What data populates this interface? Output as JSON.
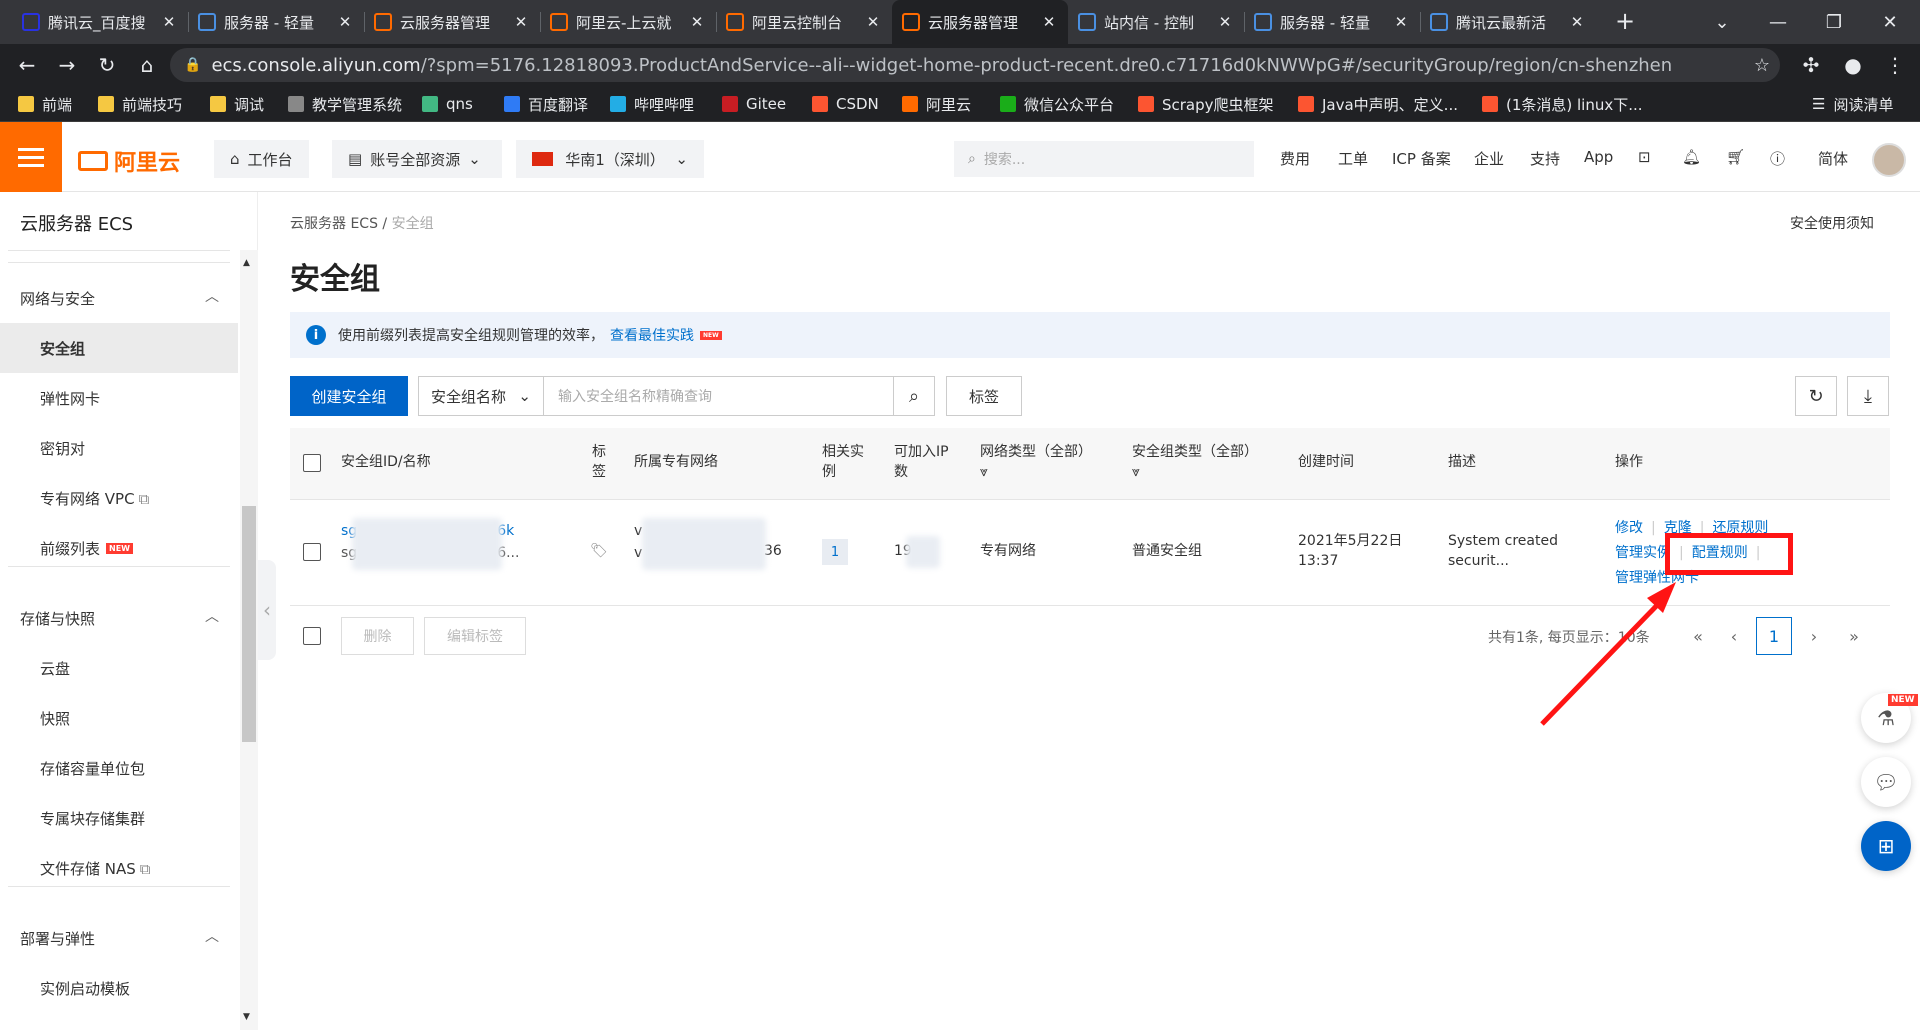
{
  "browser": {
    "tabs": [
      {
        "label": "腾讯云_百度搜",
        "icon": "baidu-icon",
        "color": "#2932e1"
      },
      {
        "label": "服务器 - 轻量",
        "icon": "tencent-cloud-icon",
        "color": "#4a90e2"
      },
      {
        "label": "云服务器管理",
        "icon": "aliyun-icon",
        "color": "#ff6a00"
      },
      {
        "label": "阿里云-上云就",
        "icon": "aliyun-icon",
        "color": "#ff6a00"
      },
      {
        "label": "阿里云控制台",
        "icon": "aliyun-icon",
        "color": "#ff6a00"
      },
      {
        "label": "云服务器管理",
        "icon": "aliyun-icon",
        "color": "#ff6a00",
        "active": true
      },
      {
        "label": "站内信 - 控制",
        "icon": "tencent-cloud-icon",
        "color": "#4a90e2"
      },
      {
        "label": "服务器 - 轻量",
        "icon": "tencent-cloud-icon",
        "color": "#4a90e2"
      },
      {
        "label": "腾讯云最新活",
        "icon": "tencent-cloud-icon",
        "color": "#4a90e2"
      }
    ],
    "url_host": "ecs.console.aliyun.com",
    "url_path": "/?spm=5176.12818093.ProductAndService--ali--widget-home-product-recent.dre0.c71716d0kNWWpG#/securityGroup/region/cn-shenzhen",
    "bookmarks": [
      {
        "label": "前端",
        "icon": "folder-icon",
        "color": "#f5c842"
      },
      {
        "label": "前端技巧",
        "icon": "folder-icon",
        "color": "#f5c842"
      },
      {
        "label": "调试",
        "icon": "folder-icon",
        "color": "#f5c842"
      },
      {
        "label": "教学管理系统",
        "icon": "building-icon",
        "color": "#888888"
      },
      {
        "label": "qns",
        "icon": "vue-icon",
        "color": "#42b883"
      },
      {
        "label": "百度翻译",
        "icon": "translate-icon",
        "color": "#2f7bf5"
      },
      {
        "label": "哔哩哔哩",
        "icon": "bilibili-icon",
        "color": "#23ade5"
      },
      {
        "label": "Gitee",
        "icon": "gitee-icon",
        "color": "#c71d23"
      },
      {
        "label": "CSDN",
        "icon": "csdn-icon",
        "color": "#fc5531"
      },
      {
        "label": "阿里云",
        "icon": "aliyun-icon",
        "color": "#ff6a00"
      },
      {
        "label": "微信公众平台",
        "icon": "wechat-icon",
        "color": "#1aad19"
      },
      {
        "label": "Scrapy爬虫框架",
        "icon": "csdn-icon",
        "color": "#fc5531"
      },
      {
        "label": "Java中声明、定义...",
        "icon": "csdn-icon",
        "color": "#fc5531"
      },
      {
        "label": "(1条消息) linux下...",
        "icon": "csdn-icon",
        "color": "#fc5531"
      }
    ],
    "reading_list": "阅读清单"
  },
  "topnav": {
    "logo": "阿里云",
    "workbench": "工作台",
    "resources": "账号全部资源",
    "region": "华南1（深圳）",
    "search_placeholder": "搜索...",
    "links": [
      "费用",
      "工单",
      "ICP 备案",
      "企业",
      "支持",
      "App"
    ],
    "lang": "简体"
  },
  "sidebar": {
    "title": "云服务器 ECS",
    "groups": [
      {
        "label": "网络与安全",
        "items": [
          "安全组",
          "弹性网卡",
          "密钥对",
          "专有网络 VPC",
          "前缀列表"
        ]
      },
      {
        "label": "存储与快照",
        "items": [
          "云盘",
          "快照",
          "存储容量单位包",
          "专属块存储集群",
          "文件存储 NAS"
        ]
      },
      {
        "label": "部署与弹性",
        "items": [
          "实例启动模板"
        ]
      }
    ],
    "new_tag": "NEW"
  },
  "main": {
    "breadcrumb": [
      "云服务器 ECS",
      "安全组"
    ],
    "notice_link": "安全使用须知",
    "title": "安全组",
    "tip_text": "使用前缀列表提高安全组规则管理的效率，",
    "tip_link": "查看最佳实践",
    "create_button": "创建安全组",
    "filter_select": "安全组名称",
    "search_placeholder": "输入安全组名称精确查询",
    "tag_button": "标签",
    "columns": [
      "安全组ID/名称",
      "标签",
      "所属专有网络",
      "相关实例",
      "可加入IP数",
      "网络类型（全部）",
      "安全组类型（全部）",
      "创建时间",
      "描述",
      "操作"
    ],
    "row": {
      "id_partial_1": "sg",
      "id_partial_1_end": "6k",
      "id_partial_2": "sg",
      "id_partial_2_end": "6...",
      "vpc_partial_1": "v",
      "vpc_partial_2": "v",
      "vpc_end": "36",
      "instances": "1",
      "ip_count": "19",
      "network_type": "专有网络",
      "sg_type": "普通安全组",
      "created": "2021年5月22日 13:37",
      "description": "System created securit...",
      "actions": [
        "修改",
        "克隆",
        "还原规则",
        "管理实例",
        "配置规则",
        "管理弹性网卡"
      ]
    },
    "delete_button": "删除",
    "edit_tag_button": "编辑标签",
    "pager_text": "共有1条, 每页显示：10条",
    "current_page": "1"
  }
}
